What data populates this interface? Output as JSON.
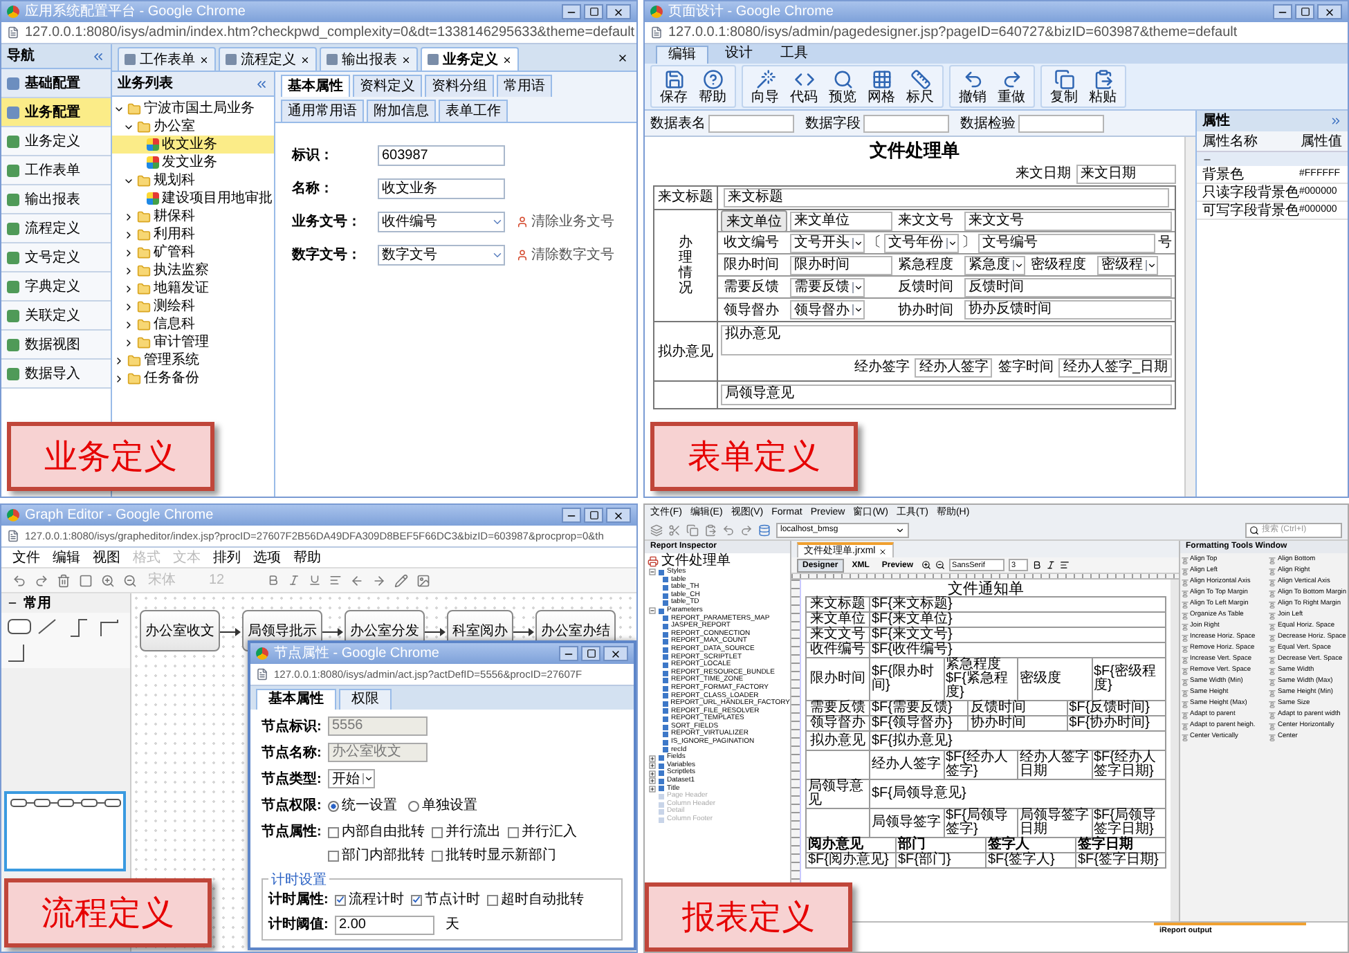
{
  "business": {
    "title": "应用系统配置平台 - Google Chrome",
    "url": "127.0.0.1:8080/isys/admin/index.htm?checkpwd_complexity=0&dt=1338146295633&theme=default",
    "caption": "业务定义",
    "nav": {
      "title": "导航",
      "items": [
        {
          "label": "基础配置",
          "kind": "header",
          "selected": false
        },
        {
          "label": "业务配置",
          "kind": "header",
          "selected": true
        },
        {
          "label": "业务定义",
          "kind": "item",
          "selected": false
        },
        {
          "label": "工作表单",
          "kind": "item",
          "selected": false
        },
        {
          "label": "输出报表",
          "kind": "item",
          "selected": false
        },
        {
          "label": "流程定义",
          "kind": "item",
          "selected": false
        },
        {
          "label": "文号定义",
          "kind": "item",
          "selected": false
        },
        {
          "label": "字典定义",
          "kind": "item",
          "selected": false
        },
        {
          "label": "关联定义",
          "kind": "item",
          "selected": false
        },
        {
          "label": "数据视图",
          "kind": "item",
          "selected": false
        },
        {
          "label": "数据导入",
          "kind": "item",
          "selected": false
        }
      ]
    },
    "tabs": [
      {
        "label": "工作表单",
        "selected": false
      },
      {
        "label": "流程定义",
        "selected": false
      },
      {
        "label": "输出报表",
        "selected": false
      },
      {
        "label": "业务定义",
        "selected": true
      }
    ],
    "tree": {
      "title": "业务列表",
      "items": [
        {
          "label": "宁波市国土局业务",
          "kind": "folder",
          "expanded": true,
          "selected": false,
          "children": [
            {
              "label": "办公室",
              "kind": "folder",
              "expanded": true,
              "selected": false,
              "children": [
                {
                  "label": "收文业务",
                  "kind": "leaf",
                  "selected": true
                },
                {
                  "label": "发文业务",
                  "kind": "leaf",
                  "selected": false
                }
              ]
            },
            {
              "label": "规划科",
              "kind": "folder",
              "expanded": true,
              "selected": false,
              "children": [
                {
                  "label": "建设项目用地审批",
                  "kind": "leaf",
                  "selected": false
                }
              ]
            },
            {
              "label": "耕保科",
              "kind": "folder",
              "expanded": false,
              "selected": false
            },
            {
              "label": "利用科",
              "kind": "folder",
              "expanded": false,
              "selected": false
            },
            {
              "label": "矿管科",
              "kind": "folder",
              "expanded": false,
              "selected": false
            },
            {
              "label": "执法监察",
              "kind": "folder",
              "expanded": false,
              "selected": false
            },
            {
              "label": "地籍发证",
              "kind": "folder",
              "expanded": false,
              "selected": false
            },
            {
              "label": "测绘科",
              "kind": "folder",
              "expanded": false,
              "selected": false
            },
            {
              "label": "信息科",
              "kind": "folder",
              "expanded": false,
              "selected": false
            },
            {
              "label": "审计管理",
              "kind": "folder",
              "expanded": false,
              "selected": false
            }
          ]
        },
        {
          "label": "管理系统",
          "kind": "folder",
          "expanded": false,
          "selected": false
        },
        {
          "label": "任务备份",
          "kind": "folder",
          "expanded": false,
          "selected": false
        }
      ]
    },
    "form_tabs": [
      {
        "label": "基本属性",
        "selected": true
      },
      {
        "label": "资料定义",
        "selected": false
      },
      {
        "label": "资料分组",
        "selected": false
      },
      {
        "label": "常用语",
        "selected": false
      },
      {
        "label": "通用常用语",
        "selected": false
      },
      {
        "label": "附加信息",
        "selected": false
      },
      {
        "label": "表单工作",
        "selected": false
      }
    ],
    "fields": [
      {
        "label": "标识：",
        "value": "603987",
        "kind": "text"
      },
      {
        "label": "名称：",
        "value": "收文业务",
        "kind": "text"
      },
      {
        "label": "业务文号：",
        "value": "收件编号",
        "kind": "select",
        "action": "清除业务文号"
      },
      {
        "label": "数字文号：",
        "value": "数字文号",
        "kind": "select",
        "action": "清除数字文号"
      }
    ]
  },
  "form_designer": {
    "title": "页面设计 - Google Chrome",
    "url": "127.0.0.1:8080/isys/admin/pagedesigner.jsp?pageID=640727&bizID=603987&theme=default",
    "caption": "表单定义",
    "ribbon_tabs": [
      {
        "label": "编辑",
        "selected": true
      },
      {
        "label": "设计",
        "selected": false
      },
      {
        "label": "工具",
        "selected": false
      }
    ],
    "tool_groups": [
      [
        "保存",
        "帮助"
      ],
      [
        "向导",
        "代码",
        "预览",
        "网格",
        "标尺"
      ],
      [
        "撤销",
        "重做"
      ],
      [
        "复制",
        "粘贴"
      ]
    ],
    "data_fields": [
      {
        "label": "数据表名"
      },
      {
        "label": "数据字段"
      },
      {
        "label": "数据检验"
      }
    ],
    "doc": {
      "title": "文件处理单",
      "date": {
        "label": "来文日期",
        "value": "来文日期"
      },
      "subject": {
        "label": "来文标题",
        "value": "来文标题"
      },
      "section": {
        "label": "办理情况",
        "rows": [
          {
            "cells": [
              {
                "kind": "button",
                "text": "来文单位"
              },
              {
                "kind": "input",
                "text": "来文单位"
              },
              {
                "kind": "label",
                "text": "来文文号"
              },
              {
                "kind": "input",
                "text": "来文文号"
              }
            ]
          },
          {
            "label": "收文编号",
            "parts": [
              {
                "kind": "select",
                "text": "文号开头"
              },
              {
                "kind": "text",
                "text": "〔"
              },
              {
                "kind": "select",
                "text": "文号年份"
              },
              {
                "kind": "text",
                "text": "〕"
              },
              {
                "kind": "input",
                "text": "文号编号"
              },
              {
                "kind": "text",
                "text": "号"
              }
            ]
          },
          {
            "cells": [
              {
                "kind": "label",
                "text": "限办时间"
              },
              {
                "kind": "input",
                "text": "限办时间"
              },
              {
                "kind": "label",
                "text": "紧急程度"
              },
              {
                "kind": "select",
                "text": "紧急度"
              },
              {
                "kind": "label",
                "text": "密级程度"
              },
              {
                "kind": "select",
                "text": "密级程"
              }
            ]
          },
          {
            "cells": [
              {
                "kind": "label",
                "text": "需要反馈"
              },
              {
                "kind": "select",
                "text": "需要反馈"
              },
              {
                "kind": "label",
                "text": "反馈时间"
              },
              {
                "kind": "input",
                "text": "反馈时间"
              }
            ]
          },
          {
            "cells": [
              {
                "kind": "label",
                "text": "领导督办"
              },
              {
                "kind": "select",
                "text": "领导督办"
              },
              {
                "kind": "label",
                "text": "协办时间"
              },
              {
                "kind": "input",
                "text": "协办反馈时间"
              }
            ]
          }
        ]
      },
      "opinions": [
        {
          "label": "拟办意见",
          "value": "拟办意见",
          "signatures": [
            {
              "label": "经办签字",
              "value": "经办人签字"
            },
            {
              "label": "签字时间",
              "value": "经办人签字_日期"
            }
          ]
        },
        {
          "value": "局领导意见"
        }
      ]
    },
    "properties": {
      "title": "属性",
      "columns": [
        "属性名称",
        "属性值"
      ],
      "rows": [
        {
          "name": "背景色",
          "value": "#FFFFFF"
        },
        {
          "name": "只读字段背景色",
          "value": "#000000"
        },
        {
          "name": "可写字段背景色",
          "value": "#000000"
        }
      ]
    }
  },
  "process": {
    "title": "Graph Editor - Google Chrome",
    "url": "127.0.0.1:8080/isys/grapheditor/index.jsp?procID=27607F2B56DA49DFA309D8BEF5F66DC3&bizID=603987&procprop=0&th",
    "caption": "流程定义",
    "menu": [
      {
        "label": "文件",
        "disabled": false
      },
      {
        "label": "编辑",
        "disabled": false
      },
      {
        "label": "视图",
        "disabled": false
      },
      {
        "label": "格式",
        "disabled": true
      },
      {
        "label": "文本",
        "disabled": true
      },
      {
        "label": "排列",
        "disabled": false
      },
      {
        "label": "选项",
        "disabled": false
      },
      {
        "label": "帮助",
        "disabled": false
      }
    ],
    "font_fields": [
      {
        "value": "宋体",
        "disabled": true
      },
      {
        "value": "12",
        "disabled": true
      }
    ],
    "sidebar": {
      "title": "常用",
      "expanded": true
    },
    "nodes": [
      "办公室收文",
      "局领导批示",
      "办公室分发",
      "科室阅办",
      "办公室办结"
    ],
    "dialog": {
      "title": "节点属性 - Google Chrome",
      "url": "127.0.0.1:8080/isys/admin/act.jsp?actDefID=5556&procID=27607F",
      "tabs": [
        {
          "label": "基本属性",
          "selected": true
        },
        {
          "label": "权限",
          "selected": false
        }
      ],
      "fields": [
        {
          "kind": "input",
          "label": "节点标识:",
          "value": "5556",
          "disabled": true
        },
        {
          "kind": "input",
          "label": "节点名称:",
          "value": "办公室收文",
          "disabled": true
        },
        {
          "kind": "select",
          "label": "节点类型:",
          "value": "开始"
        },
        {
          "kind": "radio",
          "label": "节点权限:",
          "options": [
            {
              "label": "统一设置",
              "selected": true
            },
            {
              "label": "单独设置",
              "selected": false
            }
          ]
        },
        {
          "kind": "checks",
          "label": "节点属性:",
          "options": [
            {
              "label": "内部自由批转",
              "checked": false
            },
            {
              "label": "并行流出",
              "checked": false
            },
            {
              "label": "并行汇入",
              "checked": false
            },
            {
              "label": "部门内部批转",
              "checked": false
            },
            {
              "label": "批转时显示新部门",
              "checked": false
            }
          ]
        }
      ],
      "timer": {
        "legend": "计时设置",
        "fields": [
          {
            "kind": "checks",
            "label": "计时属性:",
            "options": [
              {
                "label": "流程计时",
                "checked": true
              },
              {
                "label": "节点计时",
                "checked": true
              },
              {
                "label": "超时自动批转",
                "checked": false
              }
            ]
          },
          {
            "kind": "input",
            "label": "计时阈值:",
            "value": "2.00",
            "disabled": false,
            "unit": "天"
          }
        ]
      }
    }
  },
  "report": {
    "caption": "报表定义",
    "menu": [
      "文件(F)",
      "编辑(E)",
      "视图(V)",
      "Format",
      "Preview",
      "窗口(W)",
      "工具(T)",
      "帮助(H)"
    ],
    "connection": "localhost_bmsg",
    "search": {
      "placeholder": "搜索 (Ctrl+I)"
    },
    "inspector": {
      "title": "Report Inspector",
      "root": {
        "label": "文件处理单",
        "children": [
          {
            "label": "Styles",
            "expanded": true,
            "disabled": false,
            "children": [
              {
                "label": "table"
              },
              {
                "label": "table_TH"
              },
              {
                "label": "table_CH"
              },
              {
                "label": "table_TD"
              }
            ]
          },
          {
            "label": "Parameters",
            "expanded": true,
            "disabled": false,
            "children": [
              {
                "label": "REPORT_PARAMETERS_MAP"
              },
              {
                "label": "JASPER_REPORT"
              },
              {
                "label": "REPORT_CONNECTION"
              },
              {
                "label": "REPORT_MAX_COUNT"
              },
              {
                "label": "REPORT_DATA_SOURCE"
              },
              {
                "label": "REPORT_SCRIPTLET"
              },
              {
                "label": "REPORT_LOCALE"
              },
              {
                "label": "REPORT_RESOURCE_BUNDLE"
              },
              {
                "label": "REPORT_TIME_ZONE"
              },
              {
                "label": "REPORT_FORMAT_FACTORY"
              },
              {
                "label": "REPORT_CLASS_LOADER"
              },
              {
                "label": "REPORT_URL_HANDLER_FACTORY"
              },
              {
                "label": "REPORT_FILE_RESOLVER"
              },
              {
                "label": "REPORT_TEMPLATES"
              },
              {
                "label": "SORT_FIELDS"
              },
              {
                "label": "REPORT_VIRTUALIZER"
              },
              {
                "label": "IS_IGNORE_PAGINATION"
              },
              {
                "label": "recId"
              }
            ]
          },
          {
            "label": "Fields",
            "expanded": false,
            "disabled": false
          },
          {
            "label": "Variables",
            "expanded": false,
            "disabled": false
          },
          {
            "label": "Scriptlets",
            "expanded": false,
            "disabled": false
          },
          {
            "label": "Dataset1",
            "expanded": false,
            "disabled": false
          },
          {
            "label": "Title",
            "expanded": false,
            "disabled": false
          },
          {
            "label": "Page Header",
            "disabled": true
          },
          {
            "label": "Column Header",
            "disabled": true
          },
          {
            "label": "Detail",
            "disabled": true
          },
          {
            "label": "Column Footer",
            "disabled": true
          }
        ]
      }
    },
    "editor_tab": "文件处理单.jrxml",
    "view_tabs": [
      {
        "label": "Designer",
        "selected": true
      },
      {
        "label": "XML",
        "selected": false
      },
      {
        "label": "Preview",
        "selected": false
      }
    ],
    "font": "SansSerif",
    "font_size": "3",
    "sheet": {
      "title": "文件通知单",
      "rows": [
        {
          "kind": "row",
          "cells": [
            "来文标题",
            "$F{来文标题}"
          ]
        },
        {
          "kind": "row",
          "cells": [
            "来文单位",
            "$F{来文单位}"
          ]
        },
        {
          "kind": "row",
          "cells": [
            "来文文号",
            "$F{来文文号}"
          ]
        },
        {
          "kind": "row",
          "cells": [
            "收件编号",
            "$F{收件编号}"
          ]
        },
        {
          "kind": "row",
          "cells": [
            "限办时间",
            "$F{限办时间}",
            "紧急程度$F{紧急程度}",
            "密级度",
            "$F{密级程度}"
          ]
        },
        {
          "kind": "row",
          "cells": [
            "需要反馈",
            "$F{需要反馈}",
            "反馈时间",
            "$F{反馈时间}"
          ]
        },
        {
          "kind": "row",
          "cells": [
            "领导督办",
            "$F{领导督办}",
            "协办时间",
            "$F{协办时间}"
          ]
        },
        {
          "kind": "tall",
          "cells": [
            "拟办意见",
            "$F{拟办意见}"
          ]
        },
        {
          "kind": "row",
          "cells": [
            "",
            "经办人签字",
            "$F{经办人签字}",
            "经办人签字日期",
            "$F{经办人签字日期}"
          ]
        },
        {
          "kind": "tall",
          "cells": [
            "局领导意见",
            "$F{局领导意见}"
          ]
        },
        {
          "kind": "row",
          "cells": [
            "",
            "局领导签字",
            "$F{局领导签字}",
            "局领导签字日期",
            "$F{局领导签字日期}"
          ]
        },
        {
          "kind": "header",
          "cells": [
            "阅办意见",
            "部门",
            "签字人",
            "签字日期"
          ]
        },
        {
          "kind": "detail",
          "cells": [
            "$F{阅办意见}",
            "$F{部门}",
            "$F{签字人}",
            "$F{签字日期}"
          ]
        }
      ]
    },
    "formatting": {
      "title": "Formatting Tools Window",
      "items": [
        "Align Top",
        "Align Bottom",
        "Align Left",
        "Align Right",
        "Align Horizontal Axis",
        "Align Vertical Axis",
        "Align To Top Margin",
        "Align To Bottom Margin",
        "Align To Left Margin",
        "Align To Right Margin",
        "Organize As Table",
        "Join Left",
        "Join Right",
        "Equal Horiz. Space",
        "Increase Horiz. Space",
        "Decrease Horiz. Space",
        "Remove Horiz. Space",
        "Equal Vert. Space",
        "Increase Vert. Space",
        "Decrease Vert. Space",
        "Remove Vert. Space",
        "Same Width",
        "Same Width (Min)",
        "Same Width (Max)",
        "Same Height",
        "Same Height (Min)",
        "Same Height (Max)",
        "Same Size",
        "Adapt to parent",
        "Adapt to parent width",
        "Adapt to parent heigh.",
        "Center Horizontally",
        "Center Vertically",
        "Center"
      ]
    },
    "output": "iReport output"
  }
}
